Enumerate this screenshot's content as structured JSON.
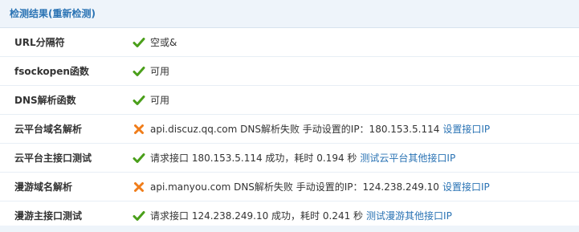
{
  "header": {
    "title": "检测结果",
    "recheck_link": "(重新检测)"
  },
  "colors": {
    "ok_icon": "#4a9f1a",
    "fail_icon": "#f07d1a",
    "link": "#2a73b4",
    "header_bg": "#eef4fa"
  },
  "rows": [
    {
      "label": "URL分隔符",
      "status": "ok",
      "icon": "check-icon",
      "text": "空或&",
      "link": ""
    },
    {
      "label": "fsockopen函数",
      "status": "ok",
      "icon": "check-icon",
      "text": "可用",
      "link": ""
    },
    {
      "label": "DNS解析函数",
      "status": "ok",
      "icon": "check-icon",
      "text": "可用",
      "link": ""
    },
    {
      "label": "云平台域名解析",
      "status": "fail",
      "icon": "cross-icon",
      "text": "api.discuz.qq.com DNS解析失败 手动设置的IP：180.153.5.114",
      "link": "设置接口IP"
    },
    {
      "label": "云平台主接口测试",
      "status": "ok",
      "icon": "check-icon",
      "text": "请求接口 180.153.5.114 成功，耗时 0.194 秒",
      "link": "测试云平台其他接口IP"
    },
    {
      "label": "漫游域名解析",
      "status": "fail",
      "icon": "cross-icon",
      "text": "api.manyou.com DNS解析失败 手动设置的IP：124.238.249.10",
      "link": "设置接口IP"
    },
    {
      "label": "漫游主接口测试",
      "status": "ok",
      "icon": "check-icon",
      "text": "请求接口 124.238.249.10 成功，耗时 0.241 秒",
      "link": "测试漫游其他接口IP"
    }
  ]
}
